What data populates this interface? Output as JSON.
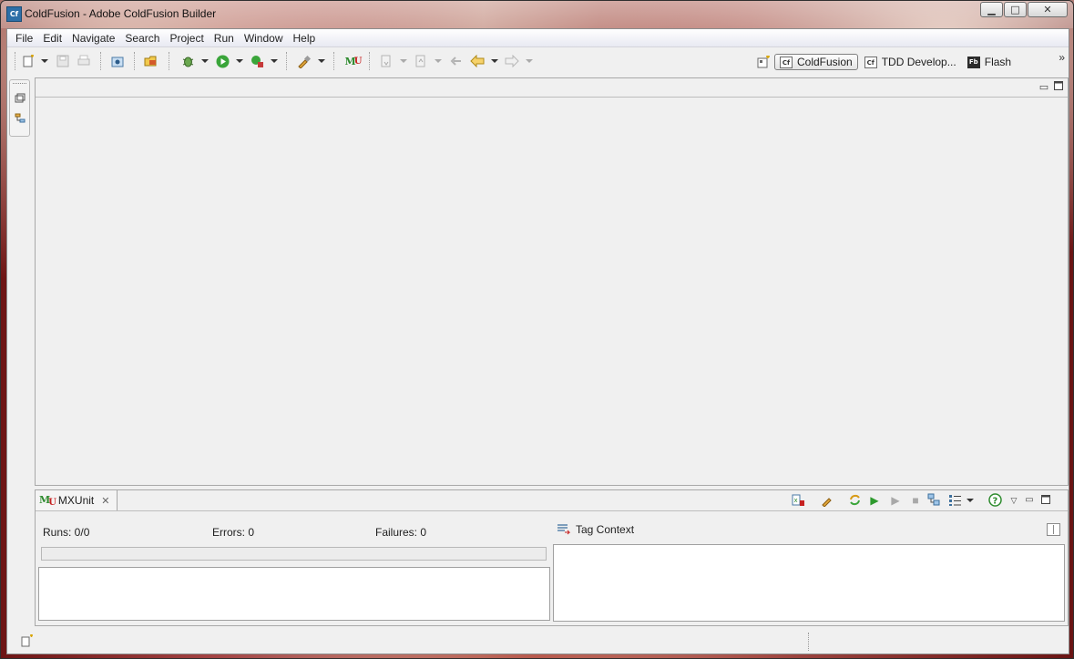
{
  "window": {
    "title": "ColdFusion - Adobe ColdFusion Builder",
    "app_icon_text": "Cf",
    "minimize": "▁",
    "maximize": "□",
    "close": "✕"
  },
  "menu": [
    "File",
    "Edit",
    "Navigate",
    "Search",
    "Project",
    "Run",
    "Window",
    "Help"
  ],
  "toolbar": {
    "mxunit_icon": "MU"
  },
  "perspectives": {
    "items": [
      {
        "icon": "Cf",
        "label": "ColdFusion",
        "active": true
      },
      {
        "icon": "Cf",
        "label": "TDD Develop...",
        "active": false
      },
      {
        "icon": "Fb",
        "label": "Flash",
        "active": false
      }
    ],
    "more": "»"
  },
  "mxunit_panel": {
    "tab_label": "MXUnit",
    "runs_label": "Runs: 0/0",
    "errors_label": "Errors: 0",
    "failures_label": "Failures: 0",
    "progress_fraction": 0,
    "tag_context_label": "Tag Context"
  },
  "colors": {
    "accent_green": "#2e8b2e",
    "accent_red": "#c62121",
    "frame_bg": "#f0f0f0"
  }
}
